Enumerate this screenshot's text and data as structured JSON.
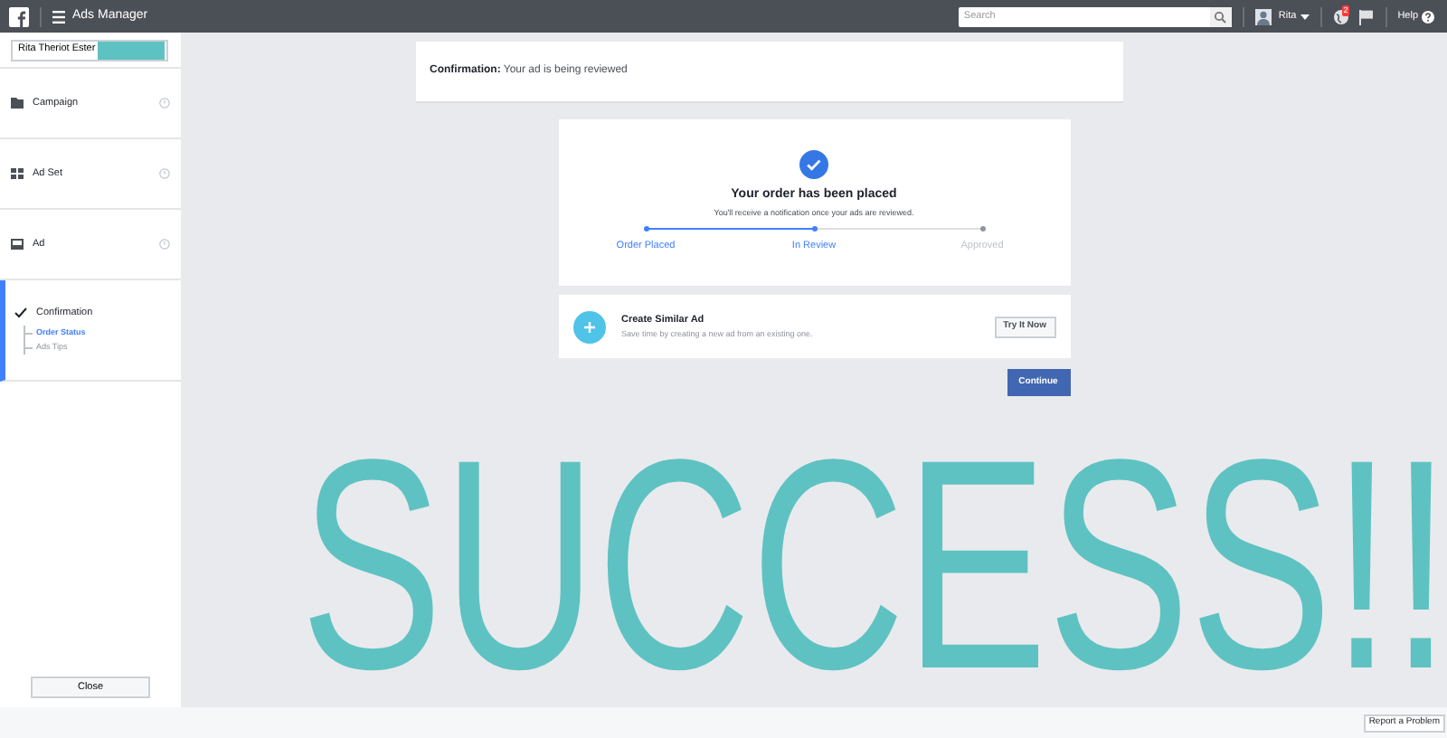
{
  "topbar": {
    "app_title": "Ads Manager",
    "search": {
      "placeholder": "Search"
    },
    "user": "Rita",
    "notification_count": "2",
    "help": "Help"
  },
  "sidebar": {
    "account": "Rita Theriot Ester",
    "items": [
      {
        "kind": "campaign",
        "label": "Campaign",
        "selected": false
      },
      {
        "kind": "adset",
        "label": "Ad Set",
        "selected": false
      },
      {
        "kind": "ad",
        "label": "Ad",
        "selected": false
      },
      {
        "kind": "confirmation",
        "label": "Confirmation",
        "selected": true,
        "children": [
          {
            "label": "Order Status",
            "selected": true
          },
          {
            "label": "Ads Tips",
            "selected": false
          }
        ]
      }
    ],
    "close": "Close"
  },
  "banner": {
    "title": "Confirmation:",
    "text": "Your ad is being reviewed"
  },
  "order": {
    "title": "Your order has been placed",
    "subtitle": "You'll receive a notification once your ads are reviewed.",
    "steps": [
      {
        "label": "Order Placed",
        "reached": true
      },
      {
        "label": "In Review",
        "reached": true
      },
      {
        "label": "Approved",
        "reached": false
      }
    ]
  },
  "similar": {
    "title": "Create Similar Ad",
    "text": "Save time by creating a new ad from an existing one.",
    "button": "Try It Now"
  },
  "continue": "Continue",
  "overlay": "SUCCESS!!",
  "footer": {
    "report": "Report a Problem"
  }
}
